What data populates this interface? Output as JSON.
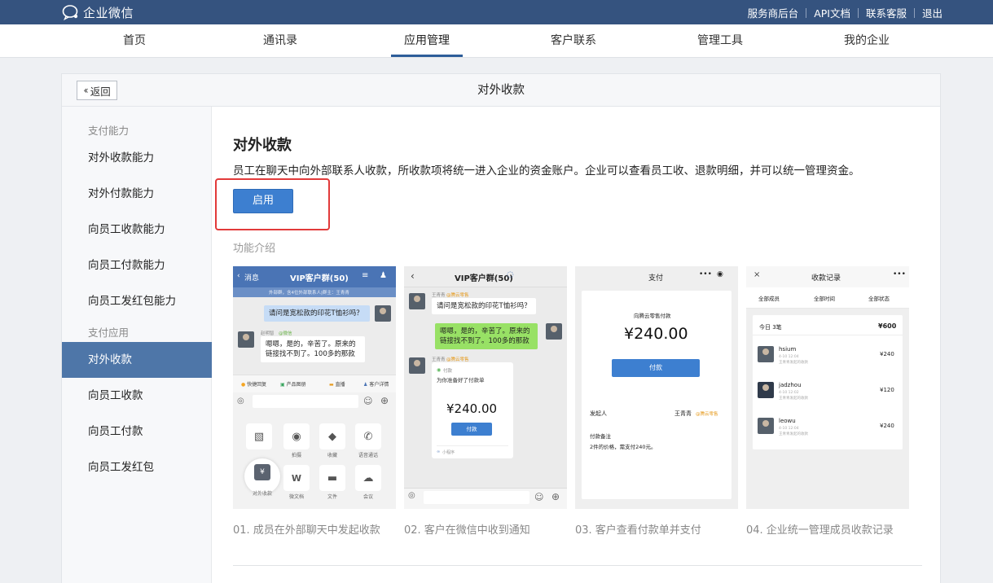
{
  "topbar": {
    "brand": "企业微信",
    "links": [
      "服务商后台",
      "API文档",
      "联系客服",
      "退出"
    ]
  },
  "nav": {
    "items": [
      "首页",
      "通讯录",
      "应用管理",
      "客户联系",
      "管理工具",
      "我的企业"
    ],
    "active_index": 2
  },
  "panel": {
    "back_label": "返回",
    "title": "对外收款"
  },
  "sidebar": {
    "group1": "支付能力",
    "group1_items": [
      "对外收款能力",
      "对外付款能力",
      "向员工收款能力",
      "向员工付款能力",
      "向员工发红包能力"
    ],
    "group2": "支付应用",
    "group2_items": [
      "对外收款",
      "向员工收款",
      "向员工付款",
      "向员工发红包"
    ],
    "active": "对外收款"
  },
  "content": {
    "title": "对外收款",
    "description": "员工在聊天中向外部联系人收款，所收款项将统一进入企业的资金账户。企业可以查看员工收、退款明细，并可以统一管理资金。",
    "enable_label": "启用",
    "intro_label": "功能介绍"
  },
  "features": [
    {
      "caption": "01. 成员在外部聊天中发起收款",
      "back": "消息",
      "chat_title": "VIP客户群(50)",
      "notice": "外部群，含4位外部联系人|群主：王青青",
      "msg_out": "请问是宽松款的印花T恤衫吗？",
      "sender": "赵明智",
      "sender_tag": "@微信",
      "msg_in": "嗯嗯，是的，辛苦了。原来的链接找不到了。100多的那款",
      "quick": [
        "快捷回复",
        "产品图册",
        "直播",
        "客户详情"
      ],
      "tiles": [
        "拍摄",
        "收藏",
        "语音通话",
        "对外收款",
        "微文档",
        "文件",
        "会议"
      ]
    },
    {
      "caption": "02. 客户在微信中收到通知",
      "chat_title": "VIP客户群(50)",
      "sender": "王青青",
      "sender_tag": "@腾云零售",
      "msg_in": "请问是宽松款的印花T恤衫吗？",
      "msg_out": "嗯嗯，是的，辛苦了。原来的链接找不到了。100多的那款",
      "card_tag": "付款",
      "card_desc": "为你准备好了付款单",
      "amount": "¥240.00",
      "pay_label": "付款",
      "mini": "小程序"
    },
    {
      "caption": "03. 客户查看付款单并支付",
      "header": "支付",
      "merchant": "向腾云零售付款",
      "amount": "¥240.00",
      "pay_label": "付款",
      "initiator_label": "发起人",
      "initiator": "王青青",
      "initiator_tag": "@腾云零售",
      "note_label": "付款备注",
      "note": "2件的价格，需支付240元。"
    },
    {
      "caption": "04. 企业统一管理成员收款记录",
      "header": "收款记录",
      "filters": [
        "全部成员",
        "全部时间",
        "全部状态"
      ],
      "today": "今日 3笔",
      "total": "¥600",
      "records": [
        {
          "name": "hsium",
          "date": "4-10 12:04",
          "from": "王青青发起的收款",
          "amount": "¥240"
        },
        {
          "name": "jadzhou",
          "date": "4-10 12:02",
          "from": "王青青发起的收款",
          "amount": "¥120"
        },
        {
          "name": "leowu",
          "date": "4-10 12:04",
          "from": "王青青发起的收款",
          "amount": "¥240"
        }
      ]
    }
  ],
  "colors": {
    "topbar": "#35537f",
    "nav_underline": "#2d5d99",
    "sidebar_active": "#4e76a8",
    "primary_button": "#3d7fd0",
    "highlight": "#e23a3a",
    "phone_header": "#4a74b5",
    "chat_green": "#98e165"
  }
}
